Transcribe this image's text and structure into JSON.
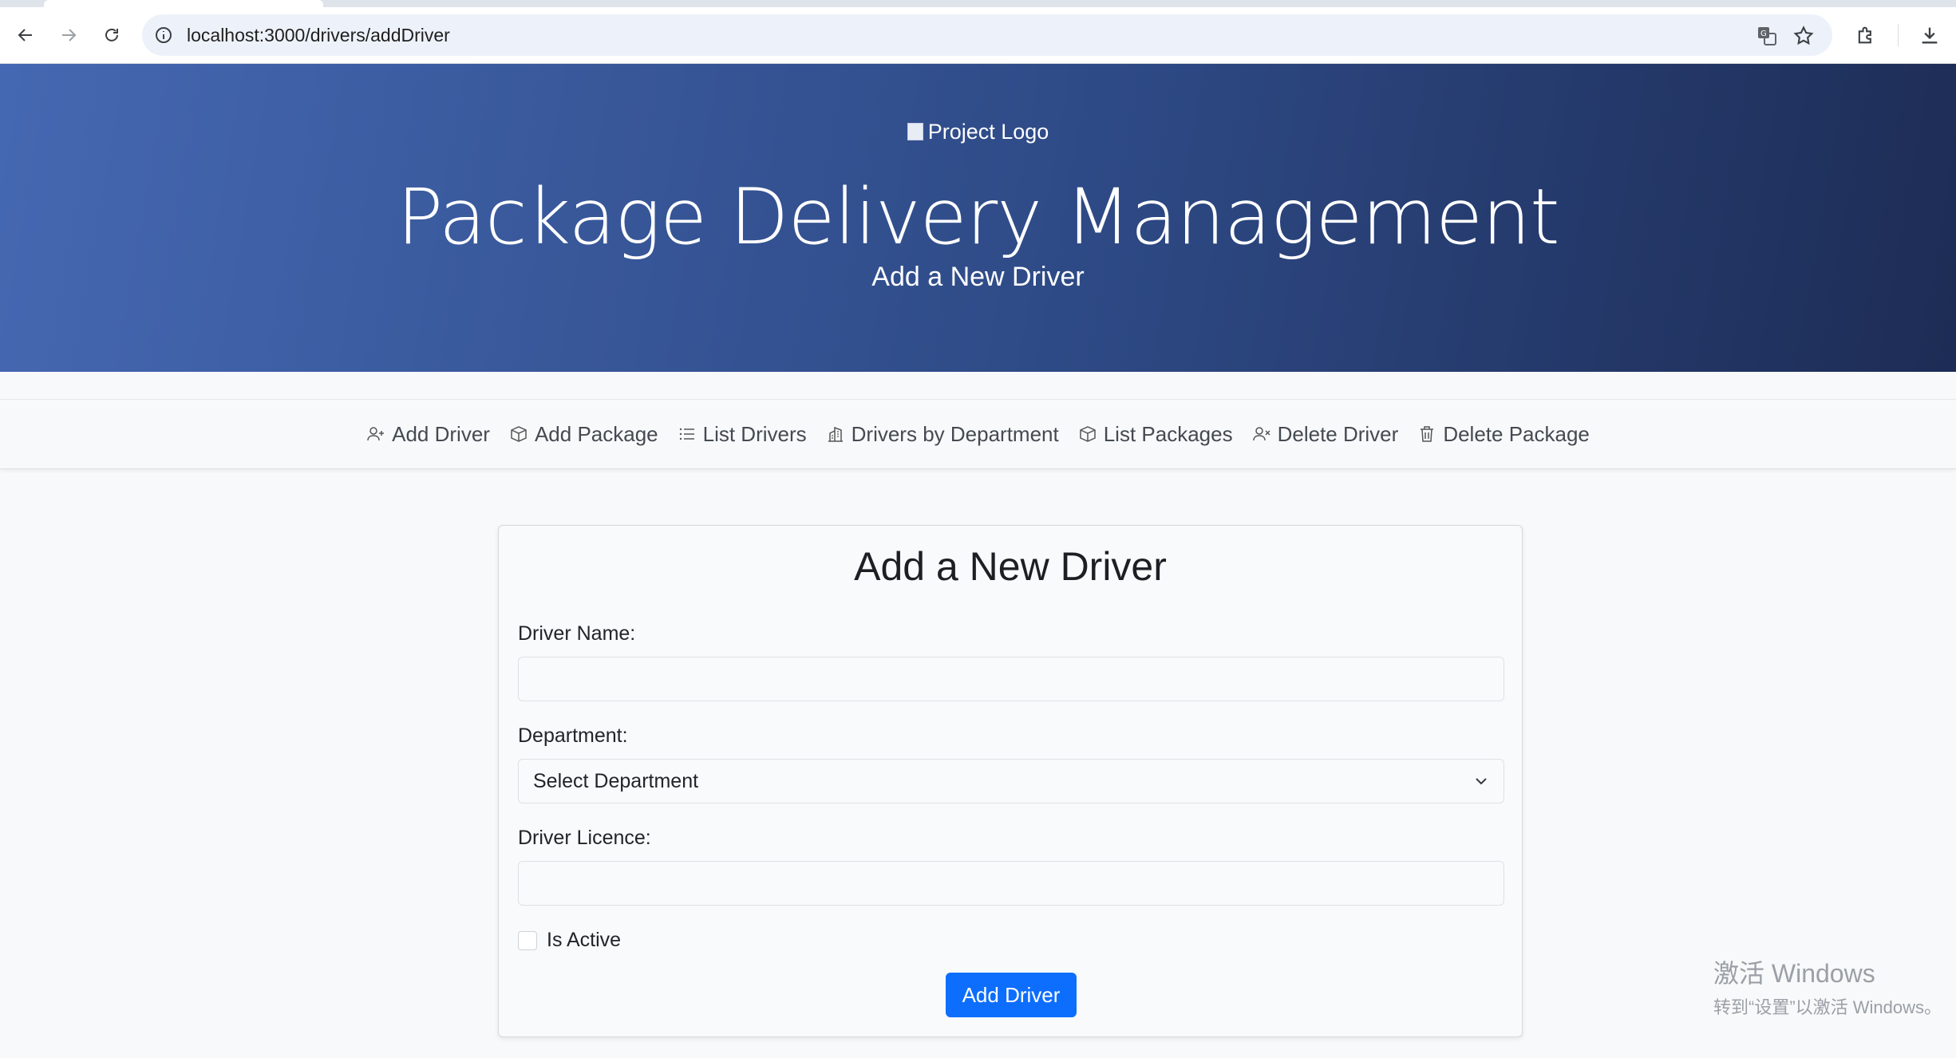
{
  "browser": {
    "url": "localhost:3000/drivers/addDriver"
  },
  "hero": {
    "logo_alt": "Project Logo",
    "title": "Package Delivery Management",
    "subtitle": "Add a New Driver"
  },
  "nav": {
    "items": [
      {
        "label": "Add Driver",
        "icon": "person-plus-icon"
      },
      {
        "label": "Add Package",
        "icon": "box-icon"
      },
      {
        "label": "List Drivers",
        "icon": "list-icon"
      },
      {
        "label": "Drivers by Department",
        "icon": "building-icon"
      },
      {
        "label": "List Packages",
        "icon": "box-icon"
      },
      {
        "label": "Delete Driver",
        "icon": "person-x-icon"
      },
      {
        "label": "Delete Package",
        "icon": "trash-icon"
      }
    ]
  },
  "form": {
    "title": "Add a New Driver",
    "name_label": "Driver Name:",
    "name_value": "",
    "department_label": "Department:",
    "department_selected": "Select Department",
    "licence_label": "Driver Licence:",
    "licence_value": "",
    "active_label": "Is Active",
    "active_checked": false,
    "submit_label": "Add Driver"
  },
  "watermark": {
    "line1": "激活 Windows",
    "line2": "转到“设置”以激活 Windows。"
  },
  "colors": {
    "hero_start": "#4568b2",
    "hero_end": "#1d2c55",
    "primary": "#0d6efd"
  }
}
